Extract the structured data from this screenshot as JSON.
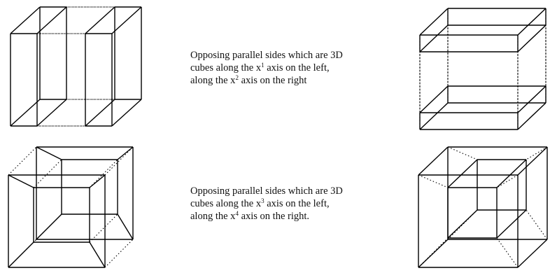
{
  "captions": [
    {
      "line1": "Opposing parallel sides which are 3D",
      "line2_pre": "cubes along the x",
      "line2_sup": "1",
      "line2_post": " axis on the left,",
      "line3_pre": "along the x",
      "line3_sup": "2",
      "line3_post": " axis on the right"
    },
    {
      "line1": "Opposing parallel sides which are 3D",
      "line2_pre": "cubes along the x",
      "line2_sup": "3",
      "line2_post": " axis on the left,",
      "line3_pre": "along the x",
      "line3_sup": "4",
      "line3_post": " axis on the right."
    }
  ],
  "colors": {
    "stroke": "#000000",
    "text": "#111111",
    "background": "#ffffff"
  }
}
